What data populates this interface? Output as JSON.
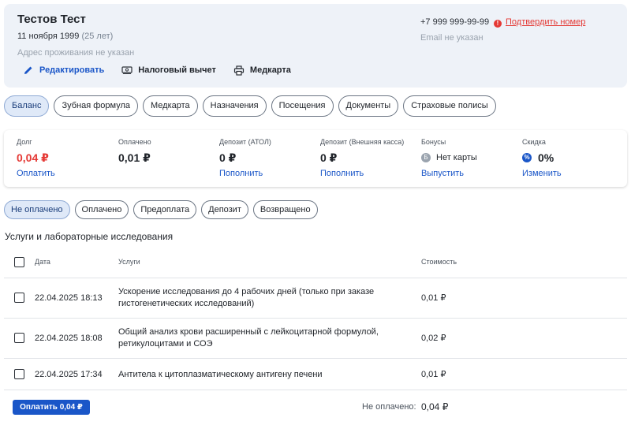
{
  "patient": {
    "name": "Тестов Тест",
    "dob": "11 ноября 1999",
    "age": "(25 лет)",
    "address": "Адрес проживания не указан",
    "phone": "+7 999 999-99-99",
    "confirm_phone": "Подтвердить номер",
    "email": "Email не указан",
    "actions": {
      "edit": "Редактировать",
      "tax": "Налоговый вычет",
      "medcard": "Медкарта"
    }
  },
  "tabs": [
    "Баланс",
    "Зубная формула",
    "Медкарта",
    "Назначения",
    "Посещения",
    "Документы",
    "Страховые полисы"
  ],
  "balance": {
    "debt": {
      "label": "Долг",
      "value": "0,04 ₽",
      "link": "Оплатить"
    },
    "paid": {
      "label": "Оплачено",
      "value": "0,01 ₽"
    },
    "deposit_atol": {
      "label": "Депозит (АТОЛ)",
      "value": "0 ₽",
      "link": "Пополнить"
    },
    "deposit_ext": {
      "label": "Депозит (Внешняя касса)",
      "value": "0 ₽",
      "link": "Пополнить"
    },
    "bonuses": {
      "label": "Бонусы",
      "value": "Нет карты",
      "link": "Выпустить",
      "icon_glyph": "Б"
    },
    "discount": {
      "label": "Скидка",
      "value": "0%",
      "link": "Изменить",
      "icon_glyph": "%"
    }
  },
  "filters": [
    "Не оплачено",
    "Оплачено",
    "Предоплата",
    "Депозит",
    "Возвращено"
  ],
  "section_title": "Услуги и лабораторные исследования",
  "table": {
    "headers": {
      "date": "Дата",
      "service": "Услуги",
      "cost": "Стоимость"
    },
    "rows": [
      {
        "date": "22.04.2025 18:13",
        "service": "Ускорение исследования до 4 рабочих дней (только при заказе гистогенетических исследований)",
        "cost": "0,01 ₽"
      },
      {
        "date": "22.04.2025 18:08",
        "service": "Общий анализ крови расширенный с лейкоцитарной формулой, ретикулоцитами и СОЭ",
        "cost": "0,02 ₽"
      },
      {
        "date": "22.04.2025 17:34",
        "service": "Антитела к цитоплазматическому антигену печени",
        "cost": "0,01 ₽"
      }
    ]
  },
  "footer": {
    "pay_button": "Оплатить 0,04 ₽",
    "unpaid_label": "Не оплачено:",
    "unpaid_total": "0,04 ₽"
  },
  "colors": {
    "accent": "#1a56c8",
    "danger": "#e53935",
    "header_bg": "#eef2f8",
    "active_chip_bg": "#dfe9f8"
  }
}
